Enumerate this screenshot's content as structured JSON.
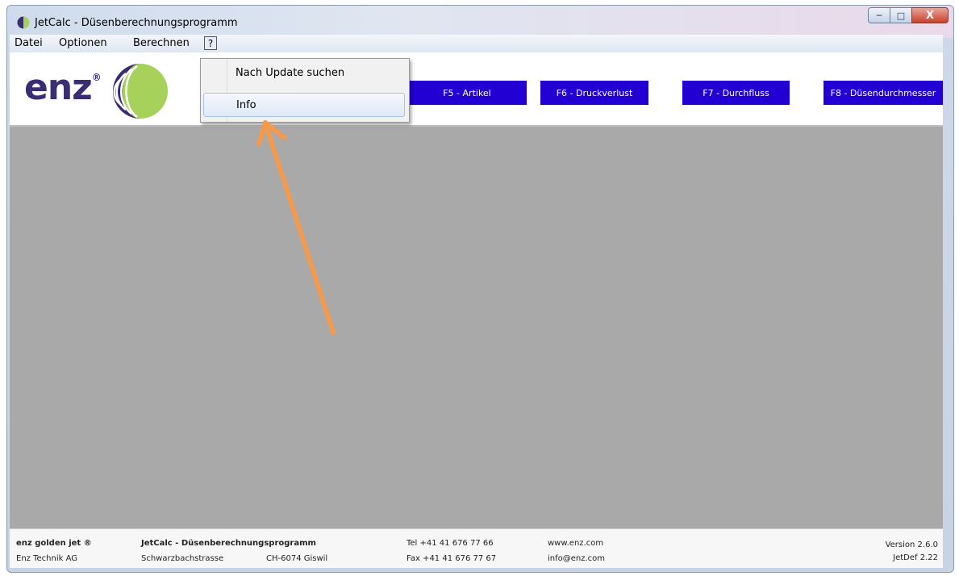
{
  "window": {
    "title": "JetCalc - Düsenberechnungsprogramm",
    "controls": {
      "minimize": "─",
      "maximize": "□",
      "close": "X"
    }
  },
  "menubar": {
    "items": [
      "Datei",
      "Optionen",
      "Berechnen"
    ],
    "help": "?"
  },
  "help_menu": {
    "items": [
      "Nach Update suchen",
      "Info"
    ],
    "highlighted": "Info"
  },
  "header": {
    "logo_text": "enz",
    "logo_reg": "®",
    "function_buttons": [
      "F5 - Artikel",
      "F6 - Druckverlust",
      "F7 - Durchfluss",
      "F8 - Düsendurchmesser"
    ],
    "button_color": "#2200d4"
  },
  "status": {
    "brand": "enz golden jet ®",
    "company": "Enz Technik AG",
    "product": "JetCalc - Düsenberechnungsprogramm",
    "street": "Schwarzbachstrasse",
    "city": "CH-6074 Giswil",
    "tel": "Tel +41 41 676 77 66",
    "fax": "Fax +41 41 676 77 67",
    "web": "www.enz.com",
    "email": "info@enz.com",
    "version": "Version 2.6.0",
    "jetdef": "JetDef 2.22"
  },
  "colors": {
    "arrow": "#f39a4d",
    "logo_purple": "#3b2d73",
    "logo_green": "#a6d15a"
  }
}
